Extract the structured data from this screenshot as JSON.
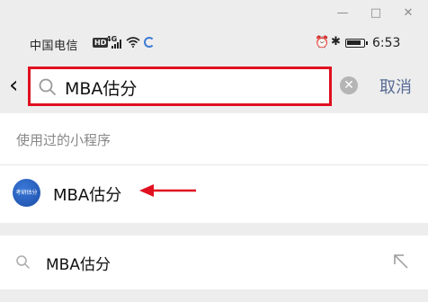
{
  "window": {
    "minimize": "—",
    "maximize": "□",
    "close": "✕"
  },
  "status_bar": {
    "carrier": "中国电信",
    "hd_badge": "HD",
    "network": "4G",
    "time": "6:53",
    "icons": [
      "signal-icon",
      "wifi-icon",
      "huawei-logo-icon",
      "alarm-icon",
      "bluetooth-icon",
      "battery-icon"
    ]
  },
  "search": {
    "back_icon": "back-chevron-icon",
    "query": "MBA估分",
    "clear_icon": "clear-circle-icon",
    "cancel_label": "取消",
    "highlight_color": "#e01020"
  },
  "recent_section": {
    "header": "使用过的小程序",
    "items": [
      {
        "name": "MBA估分",
        "avatar_text": "考研估分"
      }
    ]
  },
  "annotation": {
    "arrow_color": "#e01020"
  },
  "suggestion": {
    "text": "MBA估分",
    "fill_icon": "arrow-up-left-icon"
  },
  "colors": {
    "accent_link": "#576b95",
    "background": "#ededed"
  }
}
